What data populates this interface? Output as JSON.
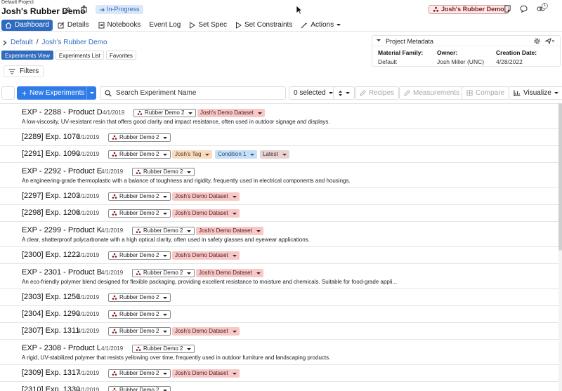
{
  "header": {
    "project_label": "Default Project",
    "title": "Josh's Rubber Demo",
    "status": "In-Progress",
    "workspace_pill": "Josh's Rubber Demo",
    "notification_count": "1"
  },
  "nav": {
    "items": [
      {
        "label": "Dashboard",
        "icon": "home-icon",
        "active": true
      },
      {
        "label": "Details",
        "icon": "edit-icon"
      },
      {
        "label": "Notebooks",
        "icon": "notebook-icon"
      },
      {
        "label": "Event Log",
        "icon": ""
      },
      {
        "label": "Set Spec",
        "icon": "play-outline-icon"
      },
      {
        "label": "Set Constraints",
        "icon": "play-outline-icon"
      },
      {
        "label": "Actions",
        "icon": "wand-icon"
      }
    ]
  },
  "breadcrumb": {
    "root": "Default",
    "separator": "/",
    "current": "Josh's Rubber Demo"
  },
  "views": {
    "tabs": [
      "Experiments View",
      "Experiments List",
      "Favorites"
    ],
    "active": 0
  },
  "filters_label": "Filters",
  "metadata": {
    "title": "Project Metadata",
    "fields": [
      {
        "key": "Material Family:",
        "value": "Default"
      },
      {
        "key": "Owner:",
        "value": "Josh Miller (UNC)"
      },
      {
        "key": "Creation Date:",
        "value": "4/28/2022"
      }
    ]
  },
  "toolbar": {
    "new_button": "New Experiments",
    "search_placeholder": "Search Experiment Name",
    "selected": "0 selected",
    "recipes": "Recipes",
    "measurements": "Measurements",
    "compare": "Compare",
    "visualize": "Visualize"
  },
  "colors": {
    "accent": "#2f6bbf",
    "primary_button": "#2f7be8",
    "dataset_tag": "#f6c9c9"
  },
  "experiments": [
    {
      "title": "EXP - 2288 - Product D",
      "date": "4/1/2019",
      "tags": [
        {
          "type": "proj",
          "label": "Rubber Demo 2"
        },
        {
          "type": "dataset",
          "label": "Josh's Demo Dataset"
        }
      ],
      "description": "A low-viscosity, UV-resistant resin that offers good clarity and impact resistance, often used in outdoor signage and displays."
    },
    {
      "title": "[2289] Exp. 1076",
      "date": "4/1/2019",
      "tags": [
        {
          "type": "proj",
          "label": "Rubber Demo 2"
        }
      ]
    },
    {
      "title": "[2291] Exp. 1090",
      "date": "4/1/2019",
      "tags": [
        {
          "type": "proj",
          "label": "Rubber Demo 2"
        },
        {
          "type": "mytag",
          "label": "Josh's Tag"
        },
        {
          "type": "cond",
          "label": "Condition 1"
        },
        {
          "type": "latest",
          "label": "Latest"
        }
      ]
    },
    {
      "title": "EXP - 2292 - Product E",
      "date": "4/1/2019",
      "tags": [
        {
          "type": "proj",
          "label": "Rubber Demo 2"
        }
      ],
      "description": "An engineering-grade thermoplastic with a balance of toughness and rigidity, frequently used in electrical components and housings."
    },
    {
      "title": "[2297] Exp. 1203",
      "date": "4/1/2019",
      "tags": [
        {
          "type": "proj",
          "label": "Rubber Demo 2"
        },
        {
          "type": "dataset",
          "label": "Josh's Demo Dataset"
        }
      ]
    },
    {
      "title": "[2298] Exp. 1206",
      "date": "4/1/2019",
      "tags": [
        {
          "type": "proj",
          "label": "Rubber Demo 2"
        },
        {
          "type": "dataset",
          "label": "Josh's Demo Dataset"
        }
      ]
    },
    {
      "title": "EXP - 2299 - Product K",
      "date": "4/1/2019",
      "tags": [
        {
          "type": "proj",
          "label": "Rubber Demo 2"
        },
        {
          "type": "dataset",
          "label": "Josh's Demo Dataset"
        }
      ],
      "description": "A clear, shatterproof polycarbonate with a high optical clarity, often used in safety glasses and eyewear applications."
    },
    {
      "title": "[2300] Exp. 1222",
      "date": "4/1/2019",
      "tags": [
        {
          "type": "proj",
          "label": "Rubber Demo 2"
        },
        {
          "type": "dataset",
          "label": "Josh's Demo Dataset"
        }
      ]
    },
    {
      "title": "EXP - 2301 - Product B",
      "date": "4/1/2019",
      "tags": [
        {
          "type": "proj",
          "label": "Rubber Demo 2"
        },
        {
          "type": "dataset",
          "label": "Josh's Demo Dataset"
        }
      ],
      "description": "An eco-friendly polymer blend designed for flexible packaging, providing excellent resistance to moisture and chemicals. Suitable for food-grade appli..."
    },
    {
      "title": "[2303] Exp. 1256",
      "date": "4/1/2019",
      "tags": [
        {
          "type": "proj",
          "label": "Rubber Demo 2"
        }
      ]
    },
    {
      "title": "[2304] Exp. 1290",
      "date": "4/1/2019",
      "tags": [
        {
          "type": "proj",
          "label": "Rubber Demo 2"
        }
      ]
    },
    {
      "title": "[2307] Exp. 1311",
      "date": "4/1/2019",
      "tags": [
        {
          "type": "proj",
          "label": "Rubber Demo 2"
        },
        {
          "type": "dataset",
          "label": "Josh's Demo Dataset"
        }
      ]
    },
    {
      "title": "EXP - 2308 - Product L",
      "date": "4/1/2019",
      "tags": [
        {
          "type": "proj",
          "label": "Rubber Demo 2"
        }
      ],
      "description": "A rigid, UV-stabilized polymer that resists yellowing over time, frequently used in outdoor furniture and landscaping products."
    },
    {
      "title": "[2309] Exp. 1317",
      "date": "4/1/2019",
      "tags": [
        {
          "type": "proj",
          "label": "Rubber Demo 2"
        },
        {
          "type": "dataset",
          "label": "Josh's Demo Dataset"
        }
      ]
    },
    {
      "title": "[2310] Exp. 1330",
      "date": "4/1/2019",
      "tags": [
        {
          "type": "proj",
          "label": "Rubber Demo 2"
        }
      ]
    }
  ]
}
